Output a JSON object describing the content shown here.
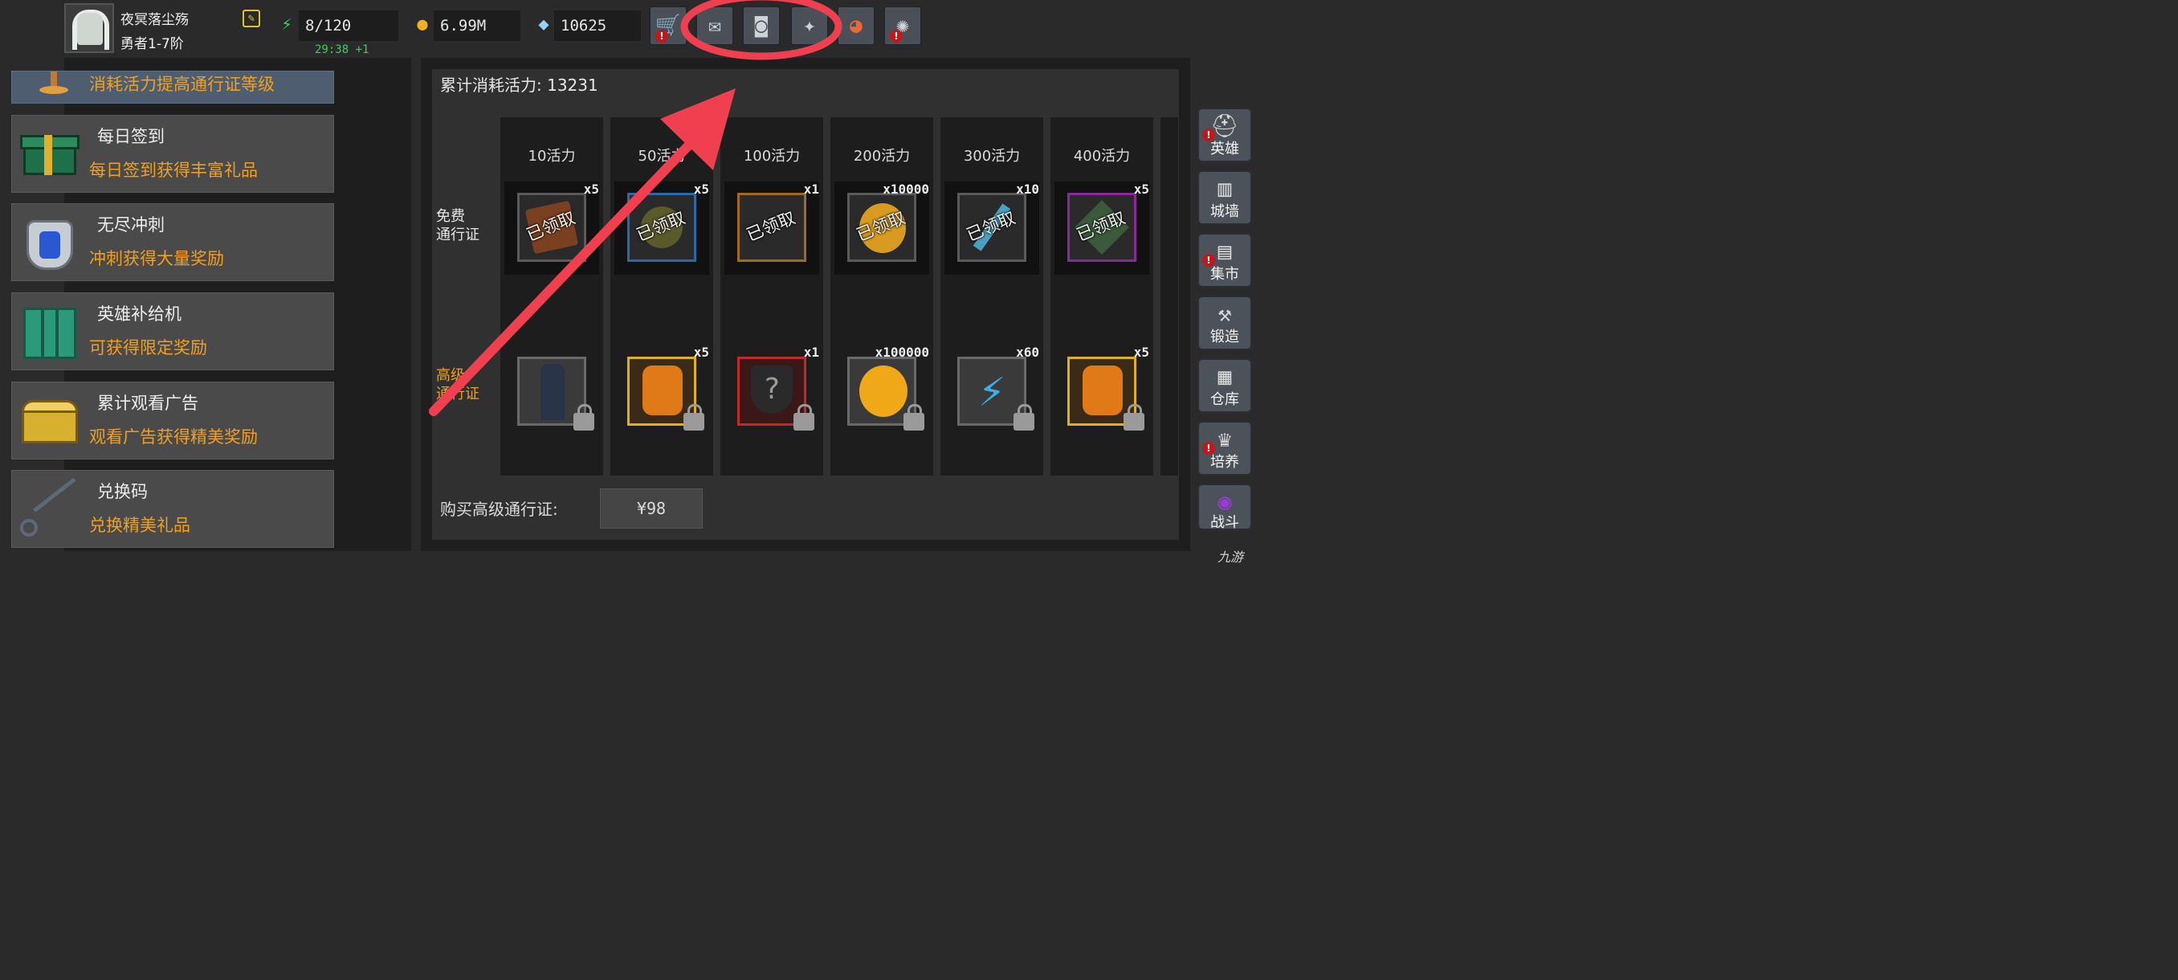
{
  "player": {
    "name": "夜冥落尘殇",
    "rank": "勇者1-7阶"
  },
  "resources": {
    "energy": "8/120",
    "energy_timer": "29:38 +1",
    "gold": "6.99M",
    "gems": "10625"
  },
  "top_buttons": [
    "shop-cart-icon",
    "mail-icon",
    "gamepad-icon",
    "puzzle-icon",
    "color-wheel-icon",
    "fireworks-icon"
  ],
  "left_menu": [
    {
      "title": "",
      "desc": "消耗活力提高通行证等级",
      "icon": "lamp-icon"
    },
    {
      "title": "每日签到",
      "desc": "每日签到获得丰富礼品",
      "icon": "gift-box-icon"
    },
    {
      "title": "无尽冲刺",
      "desc": "冲刺获得大量奖励",
      "icon": "armor-icon"
    },
    {
      "title": "英雄补给机",
      "desc": "可获得限定奖励",
      "icon": "supply-machine-icon"
    },
    {
      "title": "累计观看广告",
      "desc": "观看广告获得精美奖励",
      "icon": "treasure-chest-icon"
    },
    {
      "title": "兑换码",
      "desc": "兑换精美礼品",
      "icon": "key-icon"
    }
  ],
  "pass": {
    "total_label": "累计消耗活力: 13231",
    "free_label_line1": "免费",
    "free_label_line2": "通行证",
    "premium_label_line1": "高级",
    "premium_label_line2": "通行证",
    "claimed_text": "已领取",
    "tiers": [
      {
        "label": "10活力",
        "free_qty": "x5",
        "premium_qty": ""
      },
      {
        "label": "50活力",
        "free_qty": "x5",
        "premium_qty": "x5"
      },
      {
        "label": "100活力",
        "free_qty": "x1",
        "premium_qty": "x1"
      },
      {
        "label": "200活力",
        "free_qty": "x10000",
        "premium_qty": "x100000"
      },
      {
        "label": "300活力",
        "free_qty": "x10",
        "premium_qty": "x60"
      },
      {
        "label": "400活力",
        "free_qty": "x5",
        "premium_qty": "x5"
      }
    ],
    "buy_label": "购买高级通行证:",
    "buy_price": "¥98"
  },
  "right_rail": [
    {
      "label": "英雄",
      "icon": "helmet-icon",
      "alert": true
    },
    {
      "label": "城墙",
      "icon": "castle-wall-icon",
      "alert": false
    },
    {
      "label": "集市",
      "icon": "market-icon",
      "alert": true
    },
    {
      "label": "锻造",
      "icon": "anvil-icon",
      "alert": false
    },
    {
      "label": "仓库",
      "icon": "warehouse-icon",
      "alert": false
    },
    {
      "label": "培养",
      "icon": "trophy-icon",
      "alert": true
    },
    {
      "label": "战斗",
      "icon": "portal-icon",
      "alert": false
    }
  ],
  "watermark": "九游"
}
